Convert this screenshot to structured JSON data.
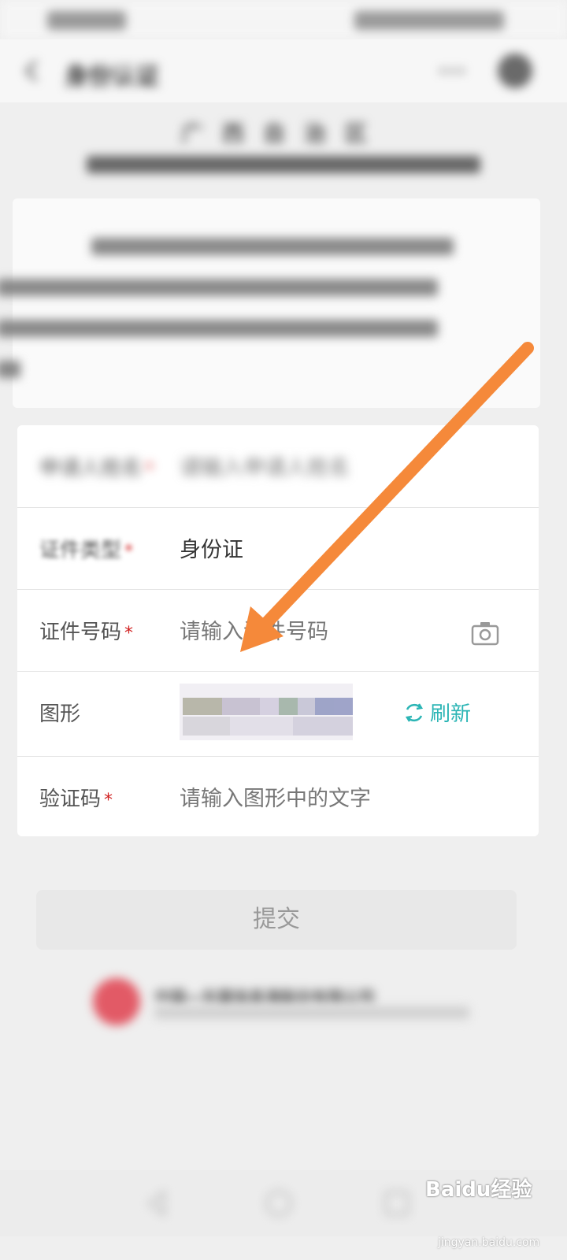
{
  "status_bar": {},
  "app_bar": {
    "title": "身份认证"
  },
  "header": {
    "line1": "广西自治区",
    "line2": ""
  },
  "intro": {
    "text": ""
  },
  "form": {
    "name": {
      "label": "申请人姓名",
      "placeholder": "请输入申请人姓名"
    },
    "cert_type": {
      "label": "证件类型",
      "value": "身份证"
    },
    "cert_number": {
      "label": "证件号码",
      "placeholder": "请输入证件号码"
    },
    "captcha": {
      "label": "图形",
      "refresh_label": "刷新"
    },
    "verify_code": {
      "label": "验证码",
      "placeholder": "请输入图形中的文字"
    }
  },
  "submit_label": "提交",
  "footer": {
    "company": "中国—东盟信息港股份有限公司"
  },
  "watermark": {
    "main": "Baidu经验",
    "sub": "jingyan.baidu.com"
  },
  "colors": {
    "accent": "#2bb5b5",
    "required": "#d02020",
    "arrow": "#f5893a"
  }
}
